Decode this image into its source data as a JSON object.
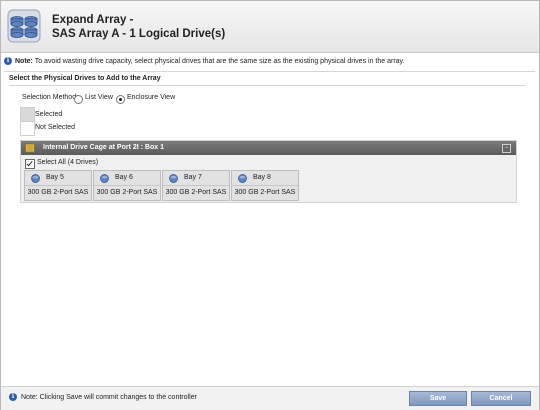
{
  "header": {
    "title_line1": "Expand Array -",
    "title_line2": "SAS Array A - 1 Logical Drive(s)",
    "icon": "array-drives-icon"
  },
  "note": {
    "label": "Note:",
    "text": "To avoid wasting drive capacity, select physical drives that are the same size as the existing physical drives in the array."
  },
  "section_title": "Select the Physical Drives to Add to the Array",
  "selection_method": {
    "label": "Selection Method:",
    "options": [
      {
        "label": "List View",
        "selected": false
      },
      {
        "label": "Enclosure View",
        "selected": true
      }
    ]
  },
  "legend": {
    "selected": "Selected",
    "not_selected": "Not Selected"
  },
  "cage": {
    "title": "Internal Drive Cage at Port 2I : Box 1",
    "select_all_label": "Select All (4 Drives)",
    "select_all_checked": true,
    "bays": [
      {
        "name": "Bay 5",
        "desc": "300 GB 2-Port SAS"
      },
      {
        "name": "Bay 6",
        "desc": "300 GB 2-Port SAS"
      },
      {
        "name": "Bay 7",
        "desc": "300 GB 2-Port SAS"
      },
      {
        "name": "Bay 8",
        "desc": "300 GB 2-Port SAS"
      }
    ]
  },
  "footer": {
    "note": "Note: Clicking Save will commit changes to the controller",
    "save_label": "Save",
    "cancel_label": "Cancel"
  },
  "colors": {
    "cage_header": "#5b5b5b",
    "button": "#8ea3c8",
    "selected_swatch": "#d9d9d9",
    "not_selected_swatch": "#ffffff"
  }
}
